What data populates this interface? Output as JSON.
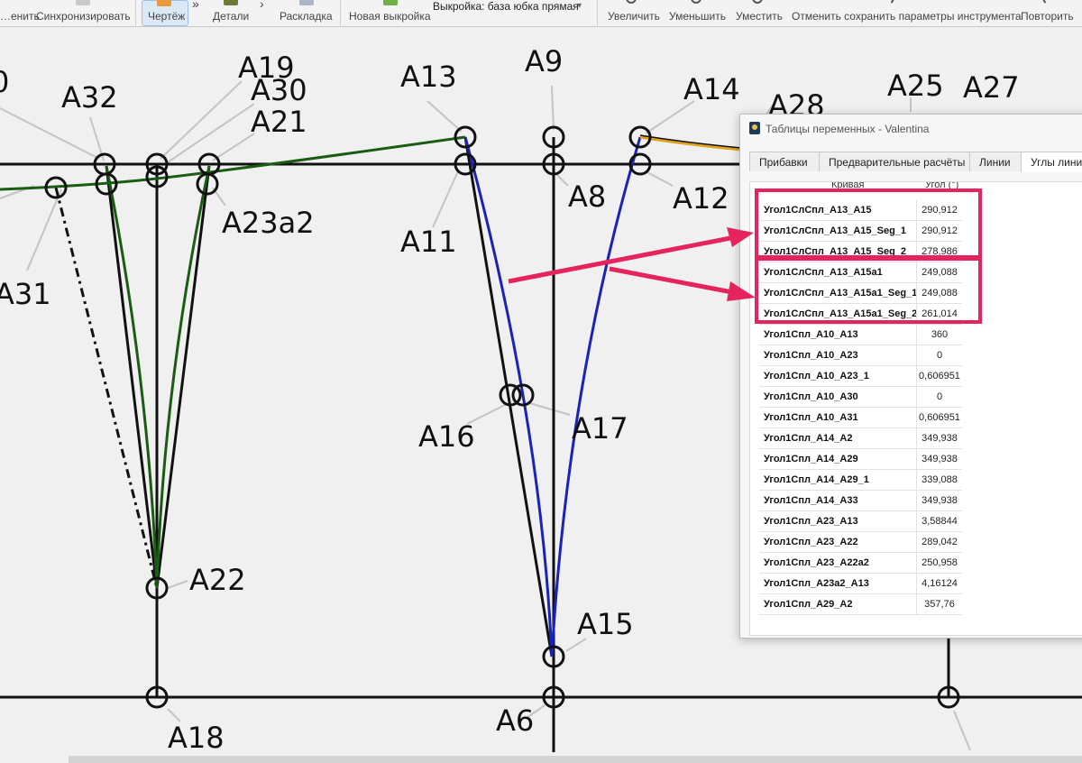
{
  "toolbar": {
    "items": [
      {
        "label": "…енить",
        "icon": "apply-icon"
      },
      {
        "label": "Синхронизировать",
        "icon": "sync-icon"
      },
      {
        "label": "Чертёж",
        "icon": "draft-icon"
      },
      {
        "label": "Детали",
        "icon": "details-icon"
      },
      {
        "label": "Раскладка",
        "icon": "layout-icon"
      },
      {
        "label": "Новая выкройка",
        "icon": "new-pattern-icon"
      },
      {
        "label": "Увеличить",
        "icon": "zoom-in-icon"
      },
      {
        "label": "Уменьшить",
        "icon": "zoom-out-icon"
      },
      {
        "label": "Уместить",
        "icon": "zoom-fit-icon"
      },
      {
        "label": "Отменить сохранить параметры инструмента",
        "icon": "cancel-icon"
      },
      {
        "label": "Повторить",
        "icon": "repeat-icon"
      }
    ],
    "pattern_select": {
      "label": "Выкройка:",
      "value": "база юбка прямая"
    }
  },
  "points": [
    "A19",
    "A30",
    "A21",
    "A32",
    "A13",
    "A9",
    "A14",
    "A28",
    "A25",
    "A27",
    "A23a2",
    "A8",
    "A12",
    "A11",
    "A31",
    "A16",
    "A17",
    "A22",
    "A15",
    "A18",
    "A6"
  ],
  "partial_label": "0",
  "dialog": {
    "title": "Таблицы переменных - Valentina",
    "tabs": [
      "Прибавки",
      "Предварительные расчёты",
      "Линии",
      "Углы линий"
    ],
    "columns": [
      "Кривая",
      "Угол (°)"
    ],
    "rows": [
      {
        "name": "Угол1СлСпл_A13_A15",
        "value": "290,912"
      },
      {
        "name": "Угол1СлСпл_A13_A15_Seg_1",
        "value": "290,912"
      },
      {
        "name": "Угол1СлСпл_A13_A15_Seg_2",
        "value": "278,986"
      },
      {
        "name": "Угол1СлСпл_A13_A15a1",
        "value": "249,088"
      },
      {
        "name": "Угол1СлСпл_A13_A15a1_Seg_1",
        "value": "249,088"
      },
      {
        "name": "Угол1СлСпл_A13_A15a1_Seg_2",
        "value": "261,014"
      },
      {
        "name": "Угол1Спл_A10_A13",
        "value": "360"
      },
      {
        "name": "Угол1Спл_A10_A23",
        "value": "0"
      },
      {
        "name": "Угол1Спл_A10_A23_1",
        "value": "0,606951"
      },
      {
        "name": "Угол1Спл_A10_A30",
        "value": "0"
      },
      {
        "name": "Угол1Спл_A10_A31",
        "value": "0,606951"
      },
      {
        "name": "Угол1Спл_A14_A2",
        "value": "349,938"
      },
      {
        "name": "Угол1Спл_A14_A29",
        "value": "349,938"
      },
      {
        "name": "Угол1Спл_A14_A29_1",
        "value": "339,088"
      },
      {
        "name": "Угол1Спл_A14_A33",
        "value": "349,938"
      },
      {
        "name": "Угол1Спл_A23_A13",
        "value": "3,58844"
      },
      {
        "name": "Угол1Спл_A23_A22",
        "value": "289,042"
      },
      {
        "name": "Угол1Спл_A23_A22a2",
        "value": "250,958"
      },
      {
        "name": "Угол1Спл_A23a2_A13",
        "value": "4,16124"
      },
      {
        "name": "Угол1Спл_A29_A2",
        "value": "357,76"
      }
    ]
  },
  "colors": {
    "highlight": "#e5245e",
    "curve_blue": "#1a22b8",
    "curve_green": "#1a5c12",
    "curve_orange": "#e0a020",
    "line": "#111111"
  }
}
